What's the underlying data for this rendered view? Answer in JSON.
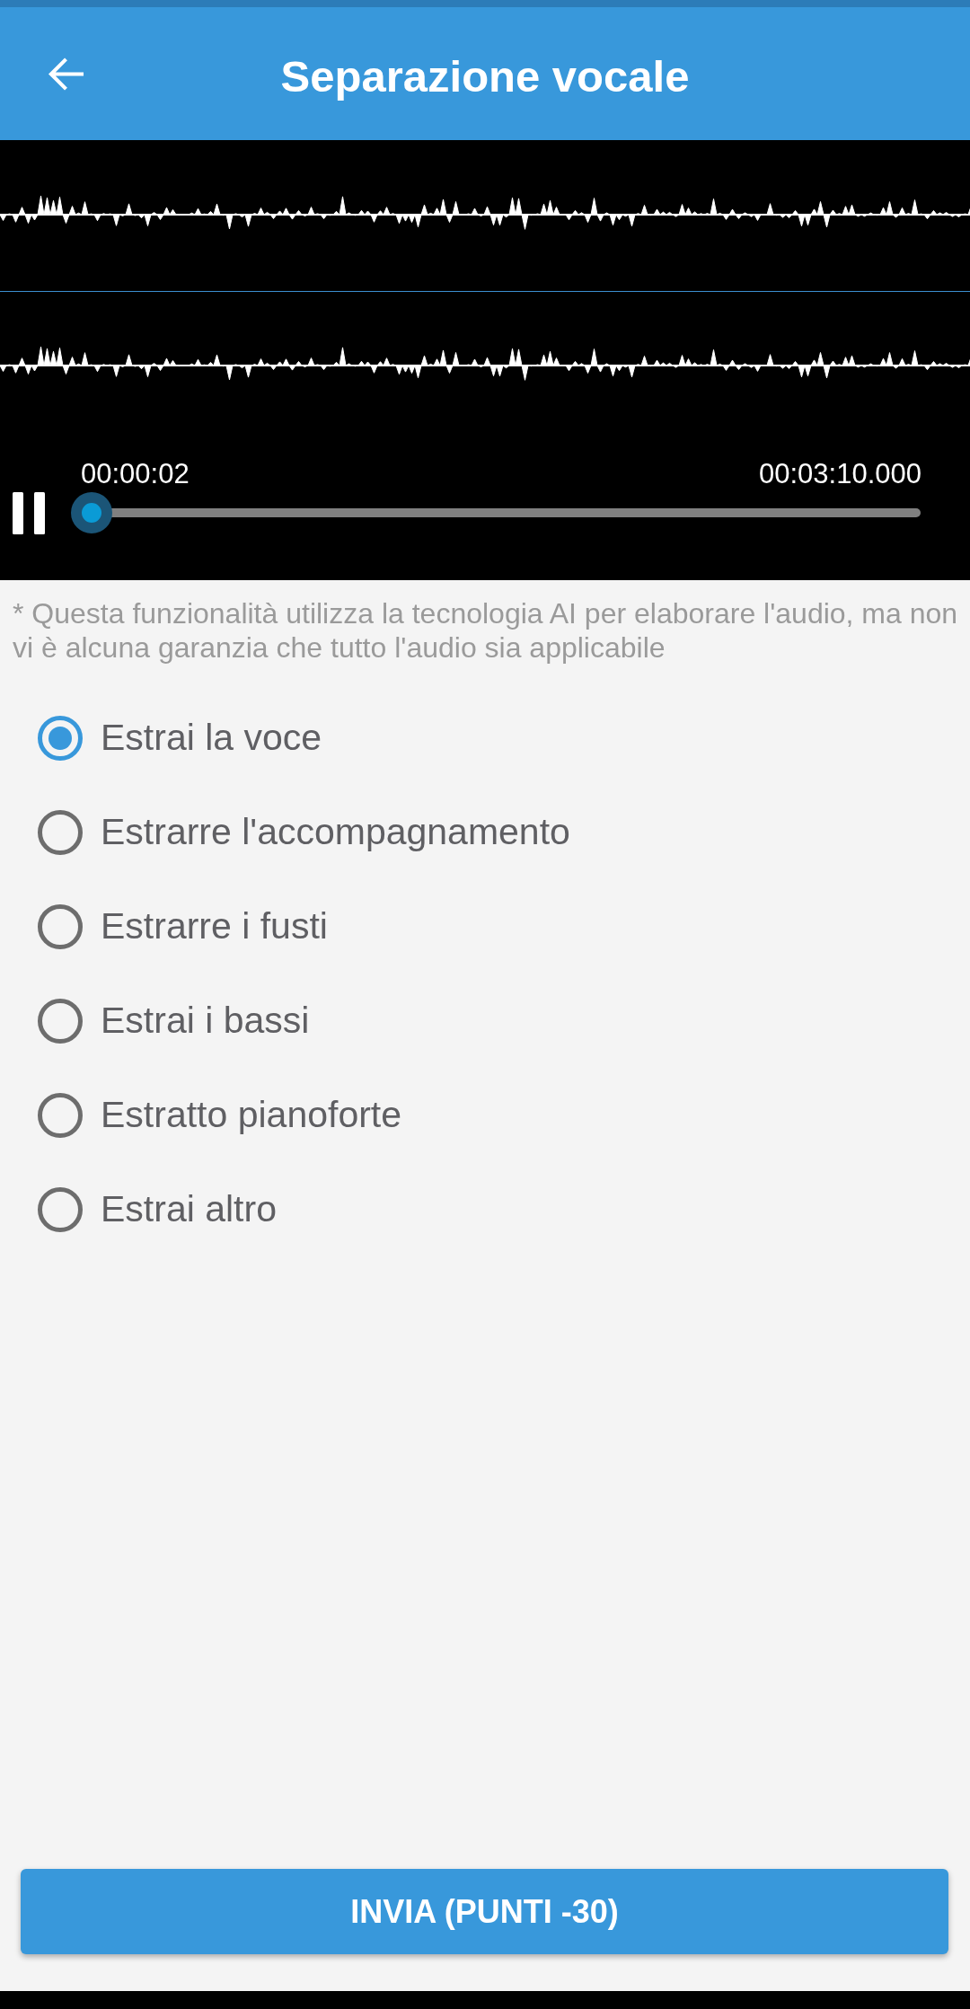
{
  "app_bar": {
    "title": "Separazione vocale"
  },
  "player": {
    "playing": true,
    "current_time": "00:00:02",
    "duration": "00:03:10.000",
    "level": 0.01
  },
  "note": "* Questa funzionalità utilizza la tecnologia AI per elaborare l'audio, ma non vi è alcuna garanzia che tutto l'audio sia applicabile",
  "options": [
    {
      "label": "Estrai la voce",
      "selected": true
    },
    {
      "label": "Estrarre l'accompagnamento",
      "selected": false
    },
    {
      "label": "Estrarre i fusti",
      "selected": false
    },
    {
      "label": "Estrai i bassi",
      "selected": false
    },
    {
      "label": "Estratto pianoforte",
      "selected": false
    },
    {
      "label": "Estrai altro",
      "selected": false
    }
  ],
  "submit_button": {
    "label": "INVIA (PUNTI -30)"
  }
}
